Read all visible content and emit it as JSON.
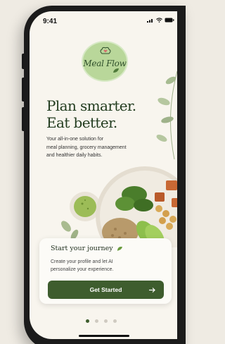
{
  "status_bar": {
    "time": "9:41"
  },
  "logo": {
    "text": "Meal Flow"
  },
  "headline": {
    "line1": "Plan smarter.",
    "line2": "Eat better."
  },
  "subtext": {
    "line1": "Your all-in-one solution for",
    "line2": "meal planning, grocery management",
    "line3": "and healthier daily habits."
  },
  "card": {
    "title": "Start your journey",
    "body_line1": "Create your profile and let AI",
    "body_line2": "personalize your experience.",
    "button_label": "Get Started",
    "button_icon": "arrow-right-icon"
  },
  "pagination": {
    "total": 4,
    "active": 1
  },
  "colors": {
    "accent": "#3e5d2e",
    "background": "#f8f5ee",
    "logo_bg": "#b9d79a"
  }
}
